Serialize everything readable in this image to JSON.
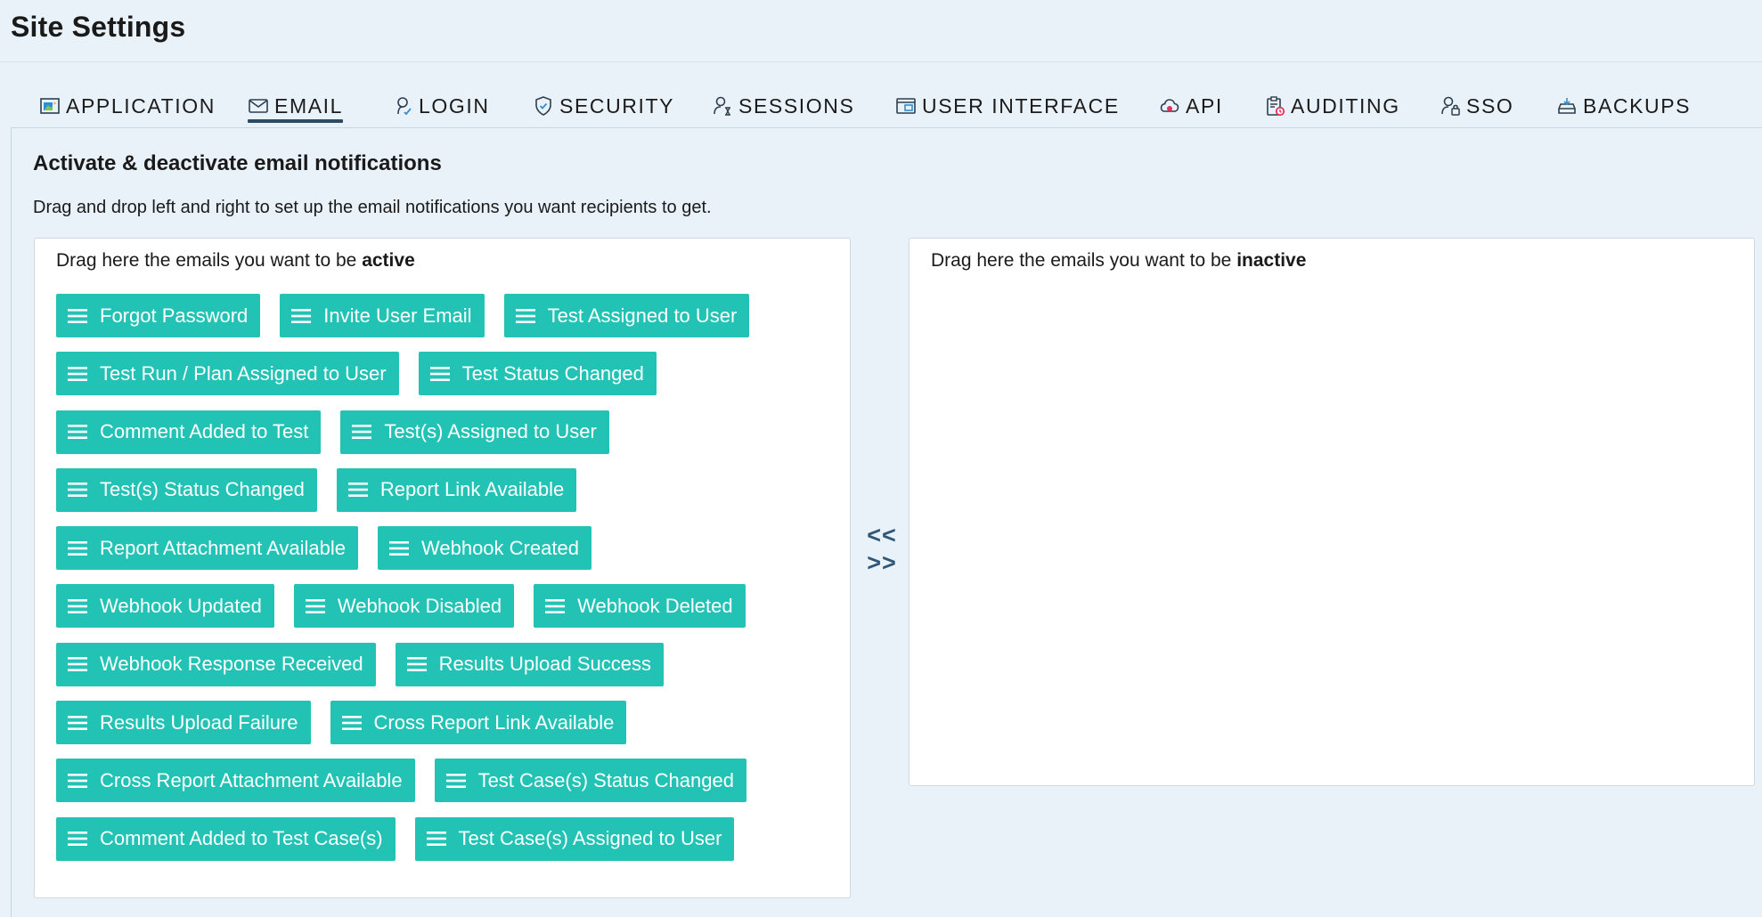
{
  "page": {
    "title": "Site Settings"
  },
  "tabs": [
    {
      "label": "APPLICATION",
      "icon": "application-icon"
    },
    {
      "label": "EMAIL",
      "icon": "email-icon",
      "active": true
    },
    {
      "label": "LOGIN",
      "icon": "login-icon"
    },
    {
      "label": "SECURITY",
      "icon": "shield-icon"
    },
    {
      "label": "SESSIONS",
      "icon": "sessions-icon"
    },
    {
      "label": "USER INTERFACE",
      "icon": "user-interface-icon"
    },
    {
      "label": "API",
      "icon": "api-cloud-icon"
    },
    {
      "label": "AUDITING",
      "icon": "auditing-clipboard-icon"
    },
    {
      "label": "SSO",
      "icon": "sso-user-lock-icon"
    },
    {
      "label": "BACKUPS",
      "icon": "backups-icon"
    }
  ],
  "section": {
    "title": "Activate & deactivate email notifications",
    "description": "Drag and drop left and right to set up the email notifications you want recipients to get."
  },
  "active_panel": {
    "caption_prefix": "Drag here the emails you want to be ",
    "caption_emphasis": "active",
    "items": [
      "Forgot Password",
      "Invite User Email",
      "Test Assigned to User",
      "Test Run / Plan Assigned to User",
      "Test Status Changed",
      "Comment Added to Test",
      "Test(s) Assigned to User",
      "Test(s) Status Changed",
      "Report Link Available",
      "Report Attachment Available",
      "Webhook Created",
      "Webhook Updated",
      "Webhook Disabled",
      "Webhook Deleted",
      "Webhook Response Received",
      "Results Upload Success",
      "Results Upload Failure",
      "Cross Report Link Available",
      "Cross Report Attachment Available",
      "Test Case(s) Status Changed",
      "Comment Added to Test Case(s)",
      "Test Case(s) Assigned to User"
    ]
  },
  "inactive_panel": {
    "caption_prefix": "Drag here the emails you want to be ",
    "caption_emphasis": "inactive",
    "items": []
  },
  "transfer": {
    "left": "<<",
    "right": ">>"
  },
  "colors": {
    "background": "#eaf2f9",
    "chip": "#22c3b5",
    "active_tab_underline": "#2d4b63",
    "arrows": "#2f5878"
  }
}
